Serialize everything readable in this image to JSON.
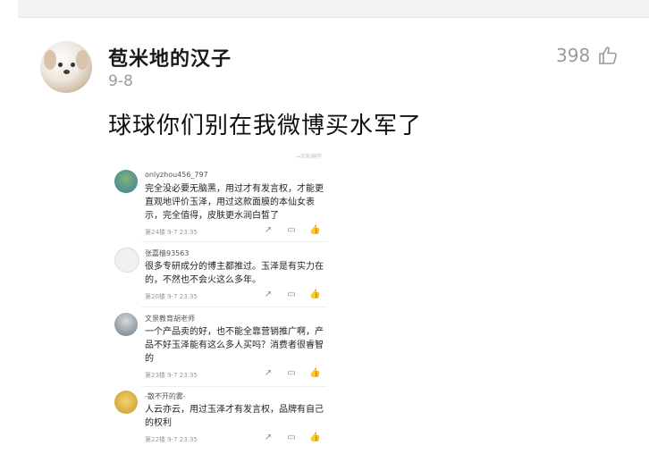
{
  "post": {
    "username": "苞米地的汉子",
    "date": "9-8",
    "like_count": "398",
    "like_icon": "thumbs-up-icon",
    "text": "球球你们别在我微博买水军了"
  },
  "screenshot": {
    "top_label": "→王彩缤卉",
    "comments": [
      {
        "name": "onlyzhou456_797",
        "text": "完全没必要无脑黑，用过才有发言权，才能更直观地评价玉泽，用过这款面膜的本仙女表示，完全值得，皮肤更水润白皙了",
        "meta": "第24楼 9-7 23:35"
      },
      {
        "name": "张嘉樯93563",
        "text": "很多专研成分的博主都推过。玉泽是有实力在的，不然也不会火这么多年。",
        "meta": "第20楼 9-7 23:35"
      },
      {
        "name": "文景教育胡老师",
        "text": "一个产品卖的好，也不能全靠营销推广啊，产品不好玉泽能有这么多人买吗？消费者很睿智的",
        "meta": "第23楼 9-7 23:35"
      },
      {
        "name": "-散不开的雾-",
        "text": "人云亦云，用过玉泽才有发言权，品牌有自己的权利",
        "meta": "第22楼 9-7 23:35"
      }
    ],
    "action_icons": [
      "share-icon",
      "comment-icon",
      "thumbs-up-icon"
    ]
  },
  "colors": {
    "text_primary": "#1a1a1a",
    "text_secondary": "#9a9a9a",
    "divider": "#eeeeee"
  }
}
